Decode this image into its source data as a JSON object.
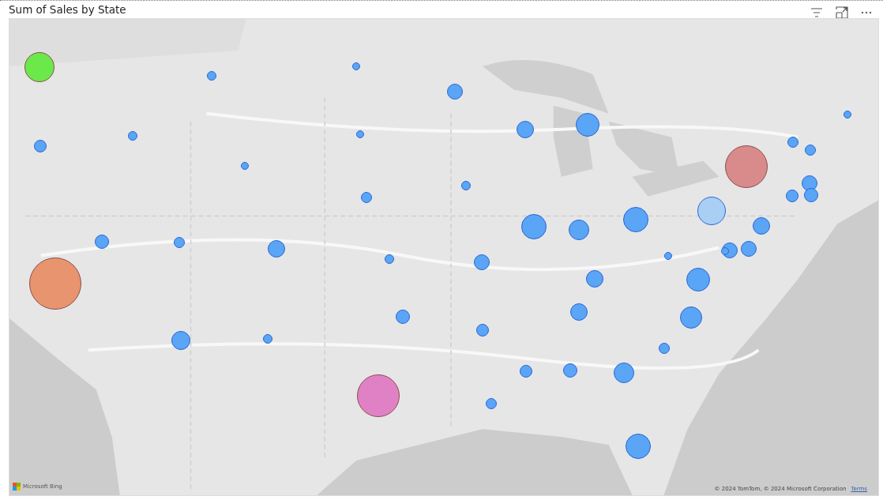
{
  "visual": {
    "title": "Sum of Sales by State"
  },
  "map": {
    "bubbles": [
      {
        "color": "#6be84a"
      },
      {
        "color": "#5aa5f5"
      },
      {
        "color": "#5aa5f5"
      },
      {
        "color": "#5aa5f5"
      },
      {
        "color": "#5aa5f5"
      },
      {
        "color": "#5aa5f5"
      },
      {
        "color": "#5aa5f5"
      },
      {
        "color": "#5aa5f5"
      },
      {
        "color": "#5aa5f5"
      },
      {
        "color": "#5aa5f5"
      },
      {
        "color": "#d98a8a"
      },
      {
        "color": "#5aa5f5"
      },
      {
        "color": "#5aa5f5"
      },
      {
        "color": "#5aa5f5"
      },
      {
        "color": "#5aa5f5"
      },
      {
        "color": "#5aa5f5"
      },
      {
        "color": "#5aa5f5"
      },
      {
        "color": "#5aa5f5"
      },
      {
        "color": "#5aa5f5"
      },
      {
        "color": "#a9cff5"
      },
      {
        "color": "#5aa5f5"
      },
      {
        "color": "#5aa5f5"
      },
      {
        "color": "#5aa5f5"
      },
      {
        "color": "#5aa5f5"
      },
      {
        "color": "#5aa5f5"
      },
      {
        "color": "#5aa5f5"
      },
      {
        "color": "#5aa5f5"
      },
      {
        "color": "#5aa5f5"
      },
      {
        "color": "#5aa5f5"
      },
      {
        "color": "#5aa5f5"
      },
      {
        "color": "#5aa5f5"
      },
      {
        "color": "#5aa5f5"
      },
      {
        "color": "#5aa5f5"
      },
      {
        "color": "#e8946e"
      },
      {
        "color": "#5aa5f5"
      },
      {
        "color": "#5aa5f5"
      },
      {
        "color": "#5aa5f5"
      },
      {
        "color": "#5aa5f5"
      },
      {
        "color": "#5aa5f5"
      },
      {
        "color": "#5aa5f5"
      },
      {
        "color": "#5aa5f5"
      },
      {
        "color": "#5aa5f5"
      },
      {
        "color": "#5aa5f5"
      },
      {
        "color": "#e081c6"
      },
      {
        "color": "#5aa5f5"
      },
      {
        "color": "#5aa5f5"
      },
      {
        "color": "#5aa5f5"
      },
      {
        "color": "#5aa5f5"
      },
      {
        "color": "#5aa5f5"
      }
    ],
    "logo_text": "Microsoft Bing",
    "attribution": "© 2024 TomTom, © 2024 Microsoft Corporation",
    "terms_link": "Terms"
  }
}
